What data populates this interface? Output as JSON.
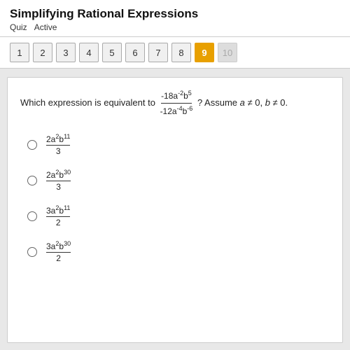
{
  "header": {
    "title": "Simplifying Rational Expressions",
    "quiz_label": "Quiz",
    "active_label": "Active"
  },
  "nav": {
    "buttons": [
      {
        "label": "1",
        "state": "normal"
      },
      {
        "label": "2",
        "state": "normal"
      },
      {
        "label": "3",
        "state": "normal"
      },
      {
        "label": "4",
        "state": "normal"
      },
      {
        "label": "5",
        "state": "normal"
      },
      {
        "label": "6",
        "state": "normal"
      },
      {
        "label": "7",
        "state": "normal"
      },
      {
        "label": "8",
        "state": "normal"
      },
      {
        "label": "9",
        "state": "active"
      },
      {
        "label": "10",
        "state": "disabled"
      }
    ]
  },
  "question": {
    "prompt_before": "Which expression is equivalent to",
    "expression_numerator": "-18a⁻²b⁵",
    "expression_denominator": "-12a⁻⁴b⁻⁶",
    "prompt_after": "? Assume a ≠ 0, b ≠ 0.",
    "options": [
      {
        "numerator": "2a²b¹¹",
        "denominator": "3"
      },
      {
        "numerator": "2a²b³⁰",
        "denominator": "3"
      },
      {
        "numerator": "3a²b¹¹",
        "denominator": "2"
      },
      {
        "numerator": "3a²b³⁰",
        "denominator": "2"
      }
    ]
  },
  "colors": {
    "active_btn": "#e8a000",
    "normal_btn": "#f0f0f0",
    "disabled_btn": "#ddd"
  }
}
